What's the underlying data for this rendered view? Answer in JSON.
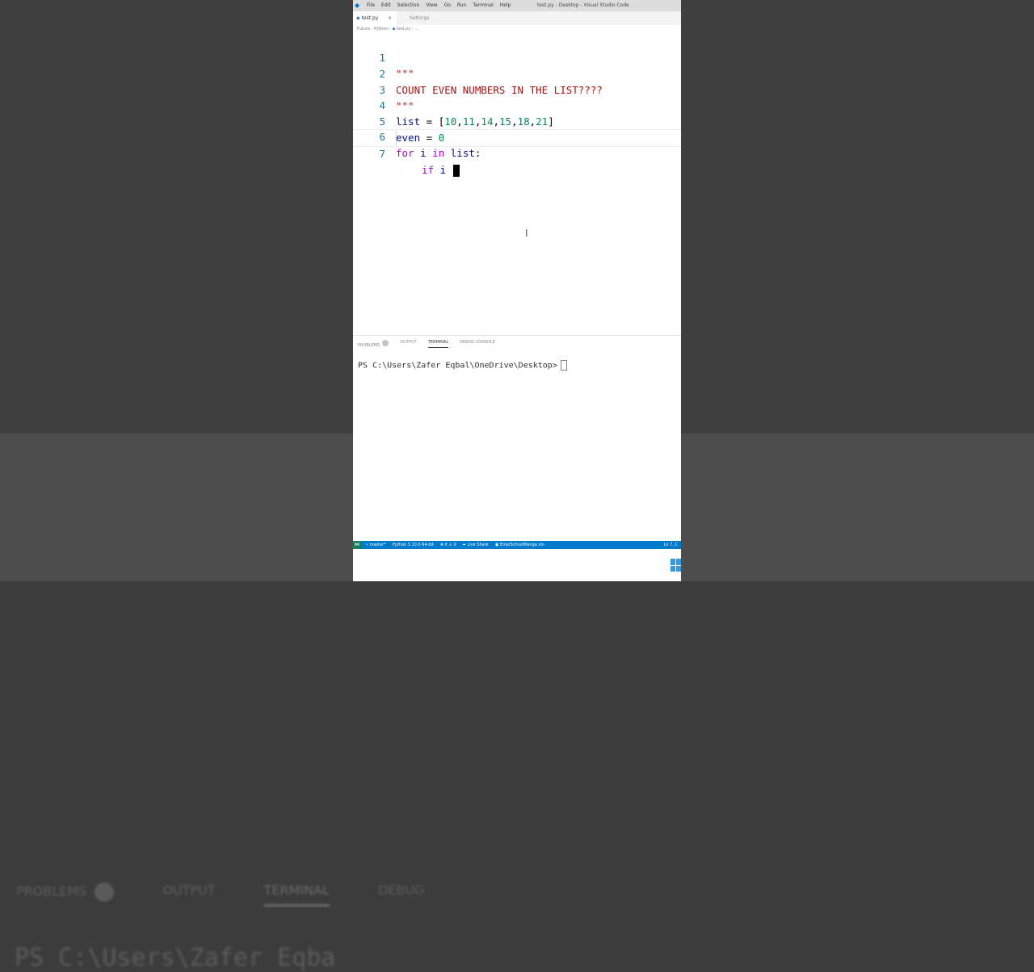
{
  "background": {
    "panel_tabs": [
      "PROBLEMS",
      "OUTPUT",
      "TERMINAL",
      "DEBUG"
    ],
    "terminal_text": "PS C:\\Users\\Zafer Eqba"
  },
  "titlebar": {
    "menu": [
      "File",
      "Edit",
      "Selection",
      "View",
      "Go",
      "Run",
      "Terminal",
      "Help"
    ],
    "title": "test.py - Desktop - Visual Studio Code"
  },
  "tabs": [
    {
      "label": "test.py",
      "active": true
    },
    {
      "label": "Settings",
      "active": false
    }
  ],
  "breadcrumb": {
    "parts": [
      "Future",
      "Python",
      "test.py",
      "..."
    ]
  },
  "editor": {
    "line_numbers": [
      "1",
      "2",
      "3",
      "4",
      "5",
      "6",
      "7"
    ],
    "current_line": 7
  },
  "panel": {
    "tabs": [
      "PROBLEMS",
      "OUTPUT",
      "TERMINAL",
      "DEBUG CONSOLE"
    ],
    "active_tab": "TERMINAL",
    "terminal_prompt": "PS C:\\Users\\Zafer Eqbal\\OneDrive\\Desktop>"
  },
  "statusbar": {
    "branch": "master*",
    "interpreter": "Python 3.10.0 64-bit",
    "problems": "⊗ 0 ⚠ 0",
    "live_share": "Live Share",
    "solution": "EmplSchoolMange.sln",
    "position": "Ln 7, C"
  },
  "colors": {
    "accent": "#007acc",
    "string": "#a31515",
    "number": "#098658",
    "keyword": "#af00db",
    "line_number": "#237893"
  }
}
